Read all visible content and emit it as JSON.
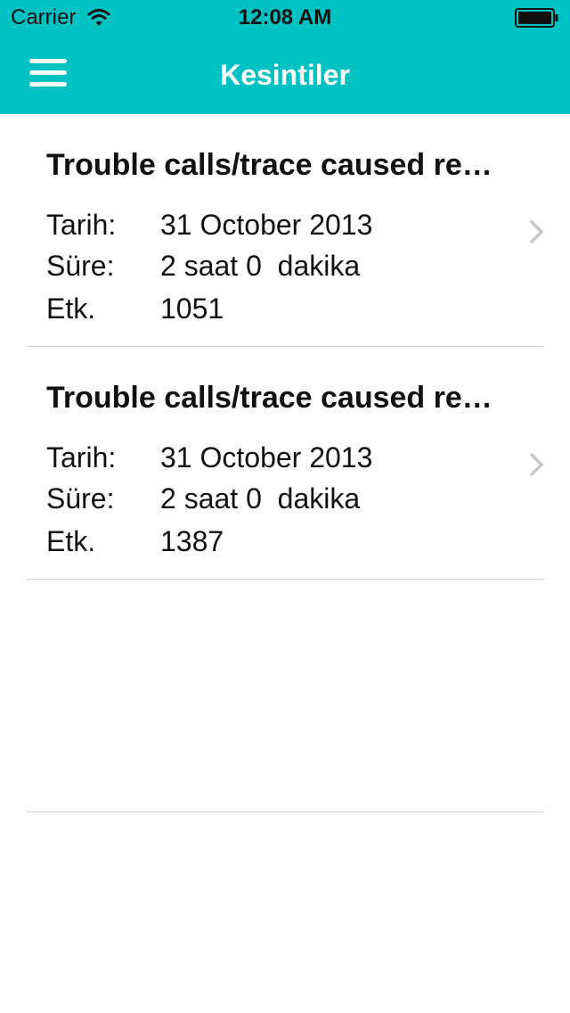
{
  "status_bar": {
    "carrier": "Carrier",
    "time": "12:08 AM"
  },
  "nav": {
    "title": "Kesintiler",
    "menu_icon": "hamburger-menu-icon",
    "background_color": "#00c2c2"
  },
  "outages": [
    {
      "title": "Trouble calls/trace caused re…",
      "date_label": "Tarih:",
      "date": "31 October 2013",
      "duration_label": "Süre:",
      "duration": "2 saat 0  dakika",
      "affected_label": "Etk.",
      "affected": "1051"
    },
    {
      "title": "Trouble calls/trace caused re…",
      "date_label": "Tarih:",
      "date": "31 October 2013",
      "duration_label": "Süre:",
      "duration": "2 saat 0  dakika",
      "affected_label": "Etk.",
      "affected": "1387"
    }
  ]
}
